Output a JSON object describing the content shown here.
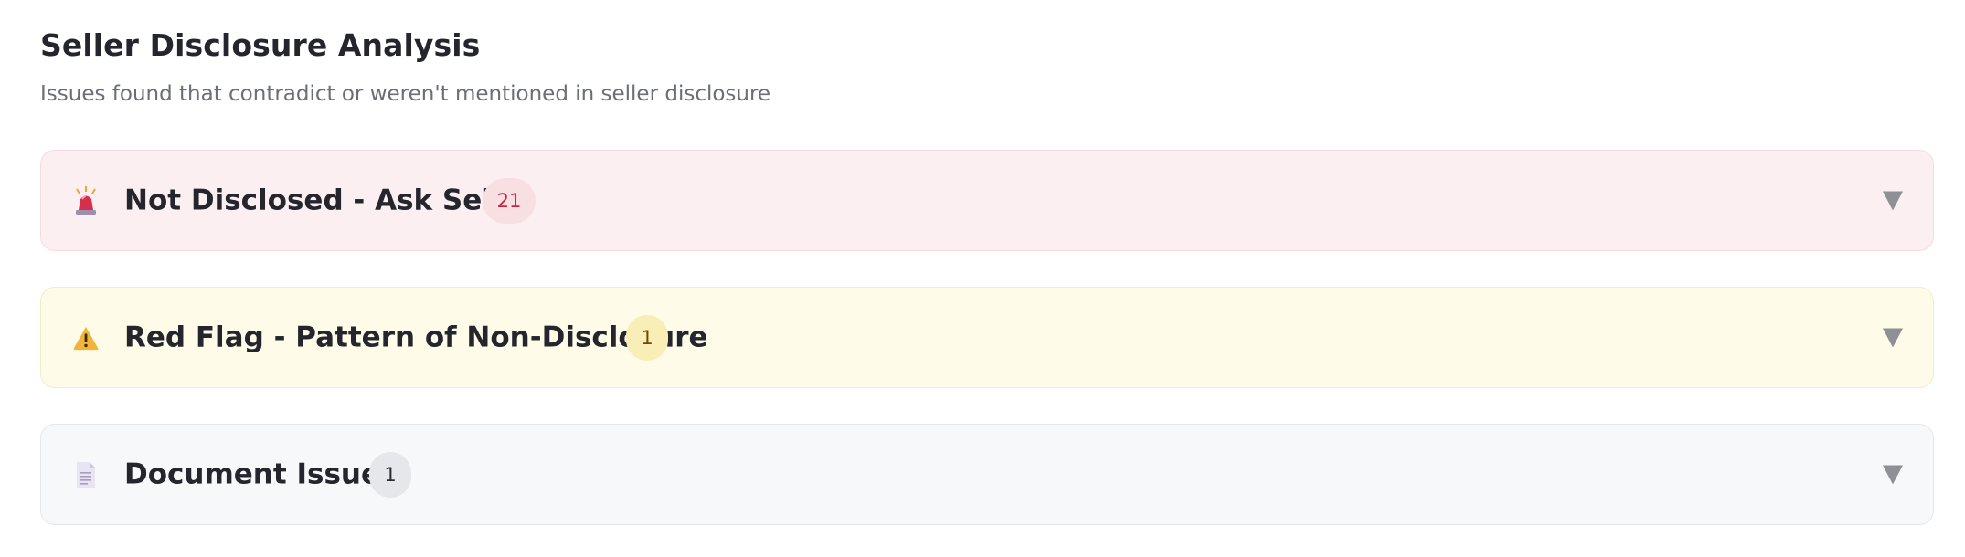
{
  "header": {
    "title": "Seller Disclosure Analysis",
    "subtitle": "Issues found that contradict or weren't mentioned in seller disclosure"
  },
  "sections": [
    {
      "label": "Not Disclosed - Ask Seller",
      "count": "21",
      "icon": "siren-icon",
      "tone": "#c6283d"
    },
    {
      "label": "Red Flag - Pattern of Non-Disclosure",
      "count": "1",
      "icon": "warning-icon",
      "tone": "#6d4a0a"
    },
    {
      "label": "Document Issues",
      "count": "1",
      "icon": "document-icon",
      "tone": "#2a2c33"
    }
  ]
}
